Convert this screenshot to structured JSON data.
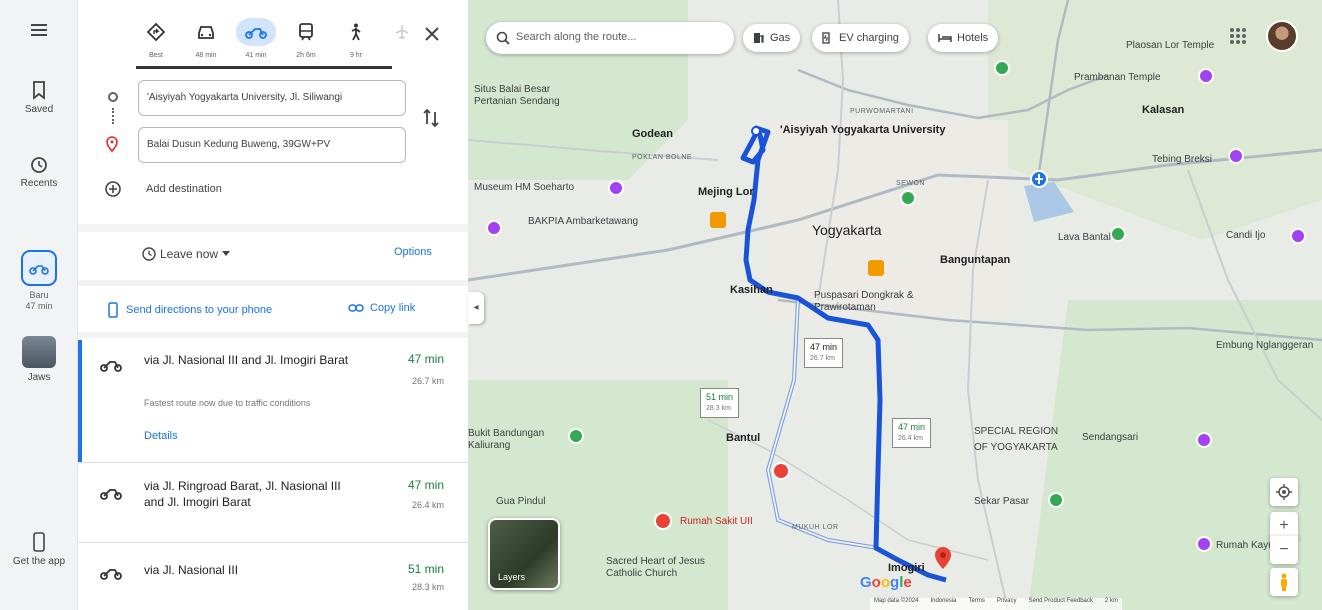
{
  "rail": {
    "saved": "Saved",
    "recents": "Recents",
    "motor_label": "Baru",
    "motor_time": "47 min",
    "jaws": "Jaws",
    "get_app": "Get the app"
  },
  "modes": [
    {
      "name": "best",
      "time": "Best"
    },
    {
      "name": "car",
      "time": "48 min"
    },
    {
      "name": "motorcycle",
      "time": "41 min"
    },
    {
      "name": "transit",
      "time": "2h 6m"
    },
    {
      "name": "walk",
      "time": "9 hr"
    }
  ],
  "directions": {
    "origin": "'Aisyiyah Yogyakarta University, Jl. Siliwangi",
    "destination": "Balai Dusun Kedung Buweng, 39GW+PV",
    "add_destination": "Add destination",
    "leave_now": "Leave now",
    "options": "Options",
    "send_phone": "Send directions to your phone",
    "copy_link": "Copy link"
  },
  "routes": [
    {
      "name": "via Jl. Nasional III and Jl. Imogiri Barat",
      "time": "47 min",
      "distance": "26.7 km",
      "note": "Fastest route now due to traffic conditions",
      "details": "Details"
    },
    {
      "name": "via Jl. Ringroad Barat, Jl. Nasional III and Jl. Imogiri Barat",
      "time": "47 min",
      "distance": "26.4 km"
    },
    {
      "name": "via Jl. Nasional III",
      "time": "51 min",
      "distance": "28.3 km"
    }
  ],
  "map": {
    "search_placeholder": "Search along the route...",
    "chips": {
      "gas": "Gas",
      "ev": "EV charging",
      "hotels": "Hotels"
    },
    "labels": {
      "aisyiyah": "'Aisyiyah Yogyakarta University",
      "yogyakarta": "Yogyakarta",
      "godean": "Godean",
      "mejing": "Mejing Lor",
      "banguntapan": "Banguntapan",
      "kasihan": "Kasihan",
      "bantul": "Bantul",
      "special_region_1": "SPECIAL REGION",
      "special_region_2": "OF YOGYAKARTA",
      "prambanan": "Prambanan Temple",
      "plaosan": "Plaosan Lor Temple",
      "kalasan": "Kalasan",
      "tebing": "Tebing Breksi",
      "lava": "Lava Bantal",
      "candi_ijo": "Candi Ijo",
      "pertanian": "Situs Balai Besar Pertanian Sendang",
      "museum": "Museum HM Soeharto",
      "ambarketawang": "BAKPIA Ambarketawang",
      "purawisata": "Puspasari Dongkrak & Prawirotaman",
      "sendangsari": "Sendangsari",
      "bandungan": "Bukit Bandungan Kaliurang",
      "gua": "Gua Pindul",
      "sekar": "Sekar Pasar",
      "rumah_sakit": "Rumah Sakit UII",
      "gereja": "Sacred Heart of Jesus Catholic Church",
      "embung": "Embung Nglanggeran",
      "rumah_kayu": "Rumah Kayu",
      "imogiri": "Imogiri",
      "small_1": "POKLAN BOLNE",
      "small_2": "PURWOMARTANI",
      "small_3": "SEWON",
      "small_4": "MUKUH LOR"
    },
    "route_boxes": {
      "main": {
        "time": "47 min",
        "distance": "26.7 km"
      },
      "alt1": {
        "time": "51 min",
        "distance": "28.3 km"
      },
      "alt2": {
        "time": "47 min",
        "distance": "26.4 km"
      }
    },
    "layers": "Layers",
    "attribution": [
      "Map data ©2024",
      "Indonesia",
      "Terms",
      "Privacy",
      "Send Product Feedback",
      "2 km"
    ]
  }
}
